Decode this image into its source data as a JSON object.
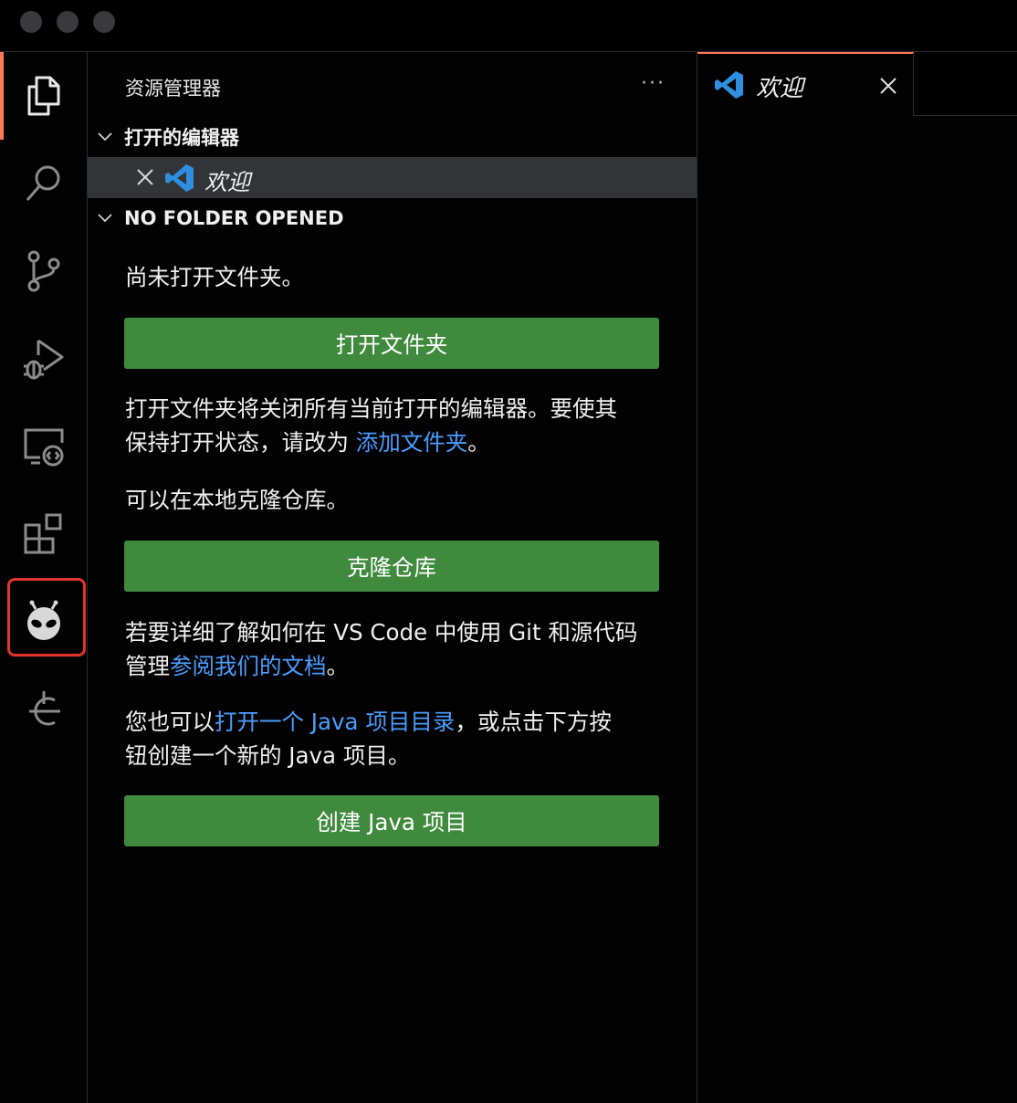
{
  "window": {
    "traffic_lights": [
      "close",
      "minimize",
      "zoom"
    ]
  },
  "activity_bar": {
    "items": [
      "explorer-icon",
      "search-icon",
      "source-control-icon",
      "run-debug-icon",
      "remote-explorer-icon",
      "extensions-icon",
      "platformio-icon",
      "gitlens-icon"
    ],
    "active": "explorer-icon",
    "highlighted": "platformio-icon",
    "accent": "#ff7755",
    "highlight_color": "#e0352b"
  },
  "sidebar": {
    "title": "资源管理器",
    "more_label": "···",
    "open_editors": {
      "header": "打开的编辑器",
      "items": [
        {
          "label": "欢迎"
        }
      ]
    },
    "no_folder": {
      "header": "NO FOLDER OPENED",
      "not_opened_text": "尚未打开文件夹。",
      "open_folder_button": "打开文件夹",
      "close_info_line1": "打开文件夹将关闭所有当前打开的编辑器。要使其",
      "close_info_line2_prefix": "保持打开状态，请改为 ",
      "close_info_link": "添加文件夹",
      "close_info_suffix": "。",
      "clone_text": "可以在本地克隆仓库。",
      "clone_button": "克隆仓库",
      "git_info_line1": "若要详细了解如何在 VS Code 中使用 Git 和源代码",
      "git_info_line2_prefix": "管理",
      "git_info_link": "参阅我们的文档",
      "git_info_suffix": "。",
      "java_prefix": "您也可以",
      "java_link": "打开一个 Java 项目目录",
      "java_suffix": "，或点击下方按",
      "java_line2": "钮创建一个新的 Java 项目。",
      "java_button": "创建 Java 项目",
      "button_color": "#3f8a3c",
      "link_color": "#4a9dff"
    }
  },
  "editor": {
    "tabs": [
      {
        "label": "欢迎",
        "active": true
      }
    ]
  }
}
